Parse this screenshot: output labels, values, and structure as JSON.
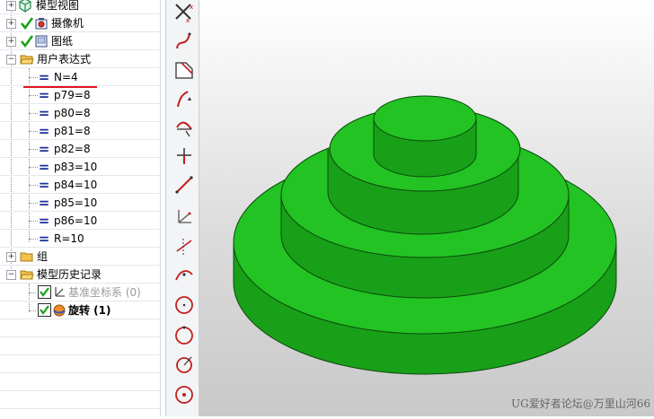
{
  "tree": {
    "model_views": "模型视图",
    "camera": "摄像机",
    "drawing": "图纸",
    "user_expressions": "用户表达式",
    "expressions": [
      "N=4",
      "p79=8",
      "p80=8",
      "p81=8",
      "p82=8",
      "p83=10",
      "p84=10",
      "p85=10",
      "p86=10",
      "R=10"
    ],
    "group": "组",
    "model_history": "模型历史记录",
    "datum_csys": "基准坐标系 (0)",
    "revolve": "旋转 (1)"
  },
  "toolbar": {
    "tools": [
      "close-x-icon",
      "spline-icon",
      "face-icon",
      "curve-arrow-icon",
      "trim-icon",
      "cross-icon",
      "line-icon",
      "axis-icon",
      "point-line-icon",
      "arc-icon",
      "circle-icon",
      "circle-dot-icon",
      "circle-arrow-icon",
      "circle-center-icon"
    ]
  },
  "viewport": {
    "model_color": "#1fb51f",
    "watermark": "UG爱好者论坛@万里山河66"
  }
}
